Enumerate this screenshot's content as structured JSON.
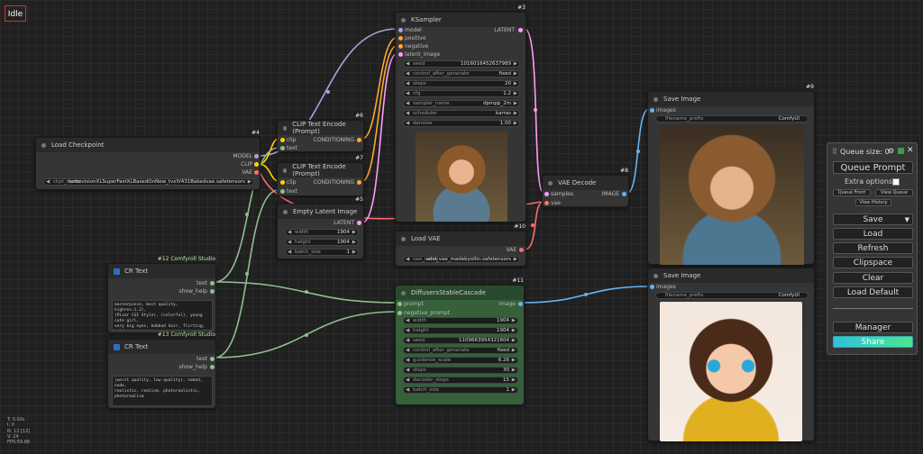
{
  "status": {
    "label": "Idle"
  },
  "stats": [
    "T: 0.00s",
    "I: 0",
    "N: 12 [12]",
    "V: 24",
    "FPS:59.88"
  ],
  "nodes": {
    "ksampler": {
      "id": "#3",
      "title": "KSampler",
      "inputs": [
        "model",
        "positive",
        "negative",
        "latent_image"
      ],
      "output": "LATENT",
      "widgets": [
        {
          "label": "seed",
          "value": "1016016452637989"
        },
        {
          "label": "control_after_generate",
          "value": "fixed"
        },
        {
          "label": "steps",
          "value": "20"
        },
        {
          "label": "cfg",
          "value": "1.2"
        },
        {
          "label": "sampler_name",
          "value": "dpmpp_2m"
        },
        {
          "label": "scheduler",
          "value": "karras"
        },
        {
          "label": "denoise",
          "value": "1.00"
        }
      ]
    },
    "clip_pos": {
      "id": "#6",
      "title": "CLIP Text Encode (Prompt)",
      "inputs": [
        "clip",
        "text"
      ],
      "output": "CONDITIONING"
    },
    "clip_neg": {
      "id": "#7",
      "title": "CLIP Text Encode (Prompt)",
      "inputs": [
        "clip",
        "text"
      ],
      "output": "CONDITIONING"
    },
    "checkpoint": {
      "id": "#4",
      "title": "Load Checkpoint",
      "outputs": [
        "MODEL",
        "CLIP",
        "VAE"
      ],
      "widget": {
        "label": "ckpt_name",
        "value": "turbovisionXLSuperFastXLBasedOnNew_tvxlV431Bakedvae.safetensors"
      }
    },
    "latent": {
      "id": "#5",
      "title": "Empty Latent Image",
      "output": "LATENT",
      "widgets": [
        {
          "label": "width",
          "value": "1904"
        },
        {
          "label": "height",
          "value": "1904"
        },
        {
          "label": "batch_size",
          "value": "1"
        }
      ]
    },
    "vae_decode": {
      "id": "#8",
      "title": "VAE Decode",
      "inputs": [
        "samples",
        "vae"
      ],
      "output": "IMAGE"
    },
    "load_vae": {
      "id": "#10",
      "title": "Load VAE",
      "output": "VAE",
      "widget": {
        "label": "vae_name",
        "value": "sdxl_vae_madebyollin.safetensors"
      }
    },
    "save1": {
      "id": "#9",
      "title": "Save Image",
      "input": "images",
      "widget": {
        "label": "filename_prefix",
        "value": "ComfyUI"
      }
    },
    "save2": {
      "id": "",
      "title": "Save Image",
      "input": "images",
      "widget": {
        "label": "filename_prefix",
        "value": "ComfyUI"
      }
    },
    "cr1": {
      "id": "#12 Comfyroll Studio",
      "title": "CR Text",
      "outputs": [
        "text",
        "show_help"
      ],
      "text": "masterpiece, best quality, highres:1.2),\n(Pixar CGI Style), (colorful), young cute girl,\nvery big eyes, bobbed hair, flirting, half\nsmile, Pixar-style, Character Design, CGI, 8k"
    },
    "cr2": {
      "id": "#13 Comfyroll Studio",
      "title": "CR Text",
      "outputs": [
        "text",
        "show_help"
      ],
      "text": "(worst quality, low quality), naked, nude,\nrealistic, realism, photorealistic,\nphotorealism"
    },
    "cascade": {
      "id": "#11",
      "title": "DiffusersStableCascade",
      "inputs": [
        "prompt",
        "negative_prompt"
      ],
      "output": "image",
      "widgets": [
        {
          "label": "width",
          "value": "1904"
        },
        {
          "label": "height",
          "value": "1904"
        },
        {
          "label": "seed",
          "value": "1109663954321604"
        },
        {
          "label": "control_after_generate",
          "value": "fixed"
        },
        {
          "label": "guidance_scale",
          "value": "6.26"
        },
        {
          "label": "steps",
          "value": "30"
        },
        {
          "label": "decoder_steps",
          "value": "15"
        },
        {
          "label": "batch_size",
          "value": "1"
        }
      ]
    }
  },
  "queue": {
    "size_label": "Queue size: 0",
    "queue_prompt": "Queue Prompt",
    "extra_options": "Extra options",
    "queue_front": "Queue Front",
    "view_queue": "View Queue",
    "view_history": "View History",
    "save": "Save",
    "load": "Load",
    "refresh": "Refresh",
    "clipspace": "Clipspace",
    "clear": "Clear",
    "load_default": "Load Default",
    "manager": "Manager",
    "share": "Share"
  },
  "colors": {
    "model": "#b39ddb",
    "clip": "#ffd500",
    "vae": "#ff6e6e",
    "conditioning": "#ffa931",
    "latent": "#ff9cf9",
    "image": "#64b5f6",
    "string": "#8fbf8f",
    "accent_share": "#2fc1dd"
  }
}
